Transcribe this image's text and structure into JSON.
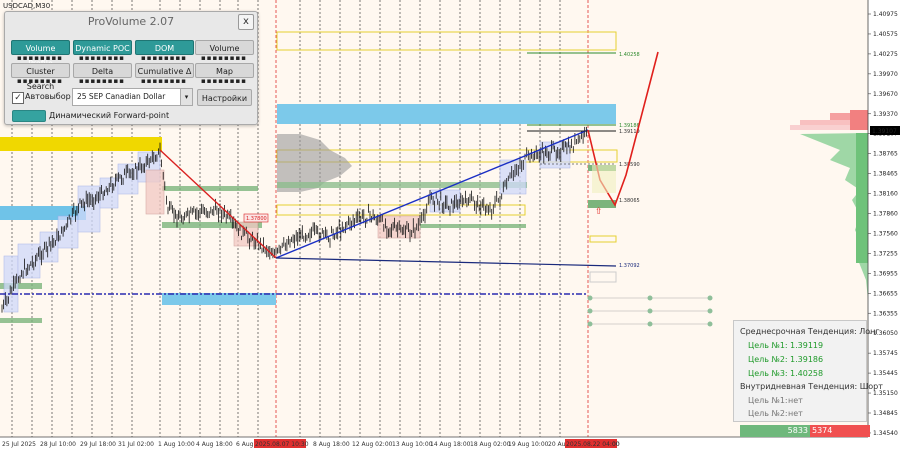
{
  "symbol": "USDCAD,M30",
  "colors": {
    "candle_up": "#000000",
    "candle_down": "#000000",
    "trend_line": "#1a2fc4",
    "forecast": "#e0201c",
    "price_label_bg": "#000000",
    "buy_bar": "#6fb87c",
    "sell_bar": "#f05050"
  },
  "panel": {
    "title": "ProVolume 2.07",
    "close": "x",
    "buttons": {
      "volume_profile": "Volume Profile",
      "dynamic_poc": "Dynamic POC",
      "dom": "DOM",
      "volume": "Volume",
      "cluster_search": "Cluster Search",
      "delta": "Delta",
      "cumulative_delta": "Cumulative Δ",
      "map": "Map",
      "settings": "Настройки"
    },
    "auto_select": {
      "label": "Автовыбор",
      "checked": true,
      "mark": "✓"
    },
    "contract": "25 SEP Canadian Dollar",
    "dropdown_icon": "chevron-down-icon",
    "forward_point": "Динамический Forward-point"
  },
  "price_axis": [
    "1.40975",
    "1.40575",
    "1.40275",
    "1.39970",
    "1.39670",
    "1.39370",
    "1.39107",
    "1.38765",
    "1.38465",
    "1.38160",
    "1.37860",
    "1.37560",
    "1.37255",
    "1.36955",
    "1.36655",
    "1.36355",
    "1.36050",
    "1.35745",
    "1.35445",
    "1.35150",
    "1.34845",
    "1.34540"
  ],
  "current_price": "1.39107",
  "date_axis": [
    "25 Jul 2025",
    "28 Jul 10:00",
    "29 Jul 18:00",
    "31 Jul 02:00",
    "1 Aug 10:00",
    "4 Aug 18:00",
    "6 Aug",
    "2025.08.07 10:30",
    "8 Aug 18:00",
    "12 Aug 02:00",
    "13 Aug 10:00",
    "14 Aug 18:00",
    "18 Aug 02:00",
    "19 Aug 10:00",
    "20 Aug",
    "2025.08.22 04:00",
    "00"
  ],
  "levels": {
    "l1": "1.40258",
    "l2": "1.39186",
    "l3": "1.39119",
    "l4": "1.38590",
    "l5": "1.38065",
    "l6": "1.37092",
    "box_label": "1.37800",
    "arrow": "⇧"
  },
  "trend_panel": {
    "medium_title": "Среднесрочная Тенденция: Лонг",
    "t1_label": "Цель №1:",
    "t1_value": "1.39119",
    "t2_label": "Цель №2:",
    "t2_value": "1.39186",
    "t3_label": "Цель №3:",
    "t3_value": "1.40258",
    "intraday_title": "Внутридневная Тенденция: Шорт",
    "i1_label": "Цель №1:",
    "i1_value": "нет",
    "i2_label": "Цель №2:",
    "i2_value": "нет"
  },
  "volume_bar": {
    "buy": "5833",
    "sell": "5374"
  }
}
